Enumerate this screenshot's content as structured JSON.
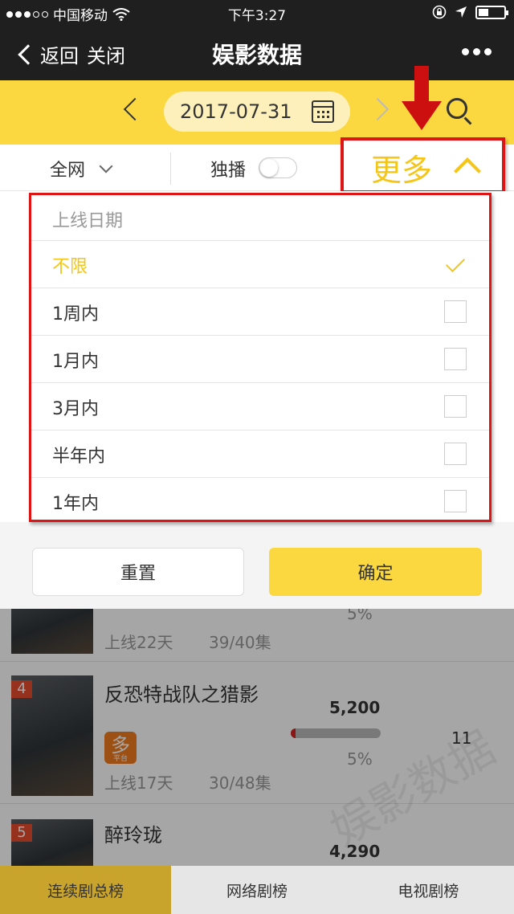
{
  "status_bar": {
    "carrier": "中国移动",
    "time": "下午3:27"
  },
  "nav": {
    "back_label": "返回",
    "close_label": "关闭",
    "title": "娱影数据"
  },
  "date_bar": {
    "date": "2017-07-31"
  },
  "filters": {
    "network": "全网",
    "exclusive_label": "独播",
    "exclusive_on": false,
    "more_label": "更多"
  },
  "dropdown": {
    "header": "上线日期",
    "options": [
      {
        "label": "不限",
        "selected": true
      },
      {
        "label": "1周内",
        "selected": false
      },
      {
        "label": "1月内",
        "selected": false
      },
      {
        "label": "3月内",
        "selected": false
      },
      {
        "label": "半年内",
        "selected": false
      },
      {
        "label": "1年内",
        "selected": false
      }
    ],
    "reset_label": "重置",
    "confirm_label": "确定"
  },
  "list": {
    "items": [
      {
        "days": "上线22天",
        "episodes": "39/40集",
        "share": "5%"
      },
      {
        "rank": "4",
        "title": "反恐特战队之猎影",
        "score": "5,200",
        "share": "5%",
        "share_value": 0.05,
        "rank_change": "11",
        "platform_icon": "多",
        "platform_sub": "平台",
        "days": "上线17天",
        "episodes": "30/48集"
      },
      {
        "rank": "5",
        "title": "醉玲珑",
        "score": "4,290"
      }
    ],
    "watermark": "娱影数据"
  },
  "tabs": [
    {
      "label": "连续剧总榜",
      "active": true
    },
    {
      "label": "网络剧榜",
      "active": false
    },
    {
      "label": "电视剧榜",
      "active": false
    }
  ],
  "colors": {
    "accent": "#fcd840",
    "highlight": "#dd1515",
    "selected_text": "#f5c518"
  }
}
